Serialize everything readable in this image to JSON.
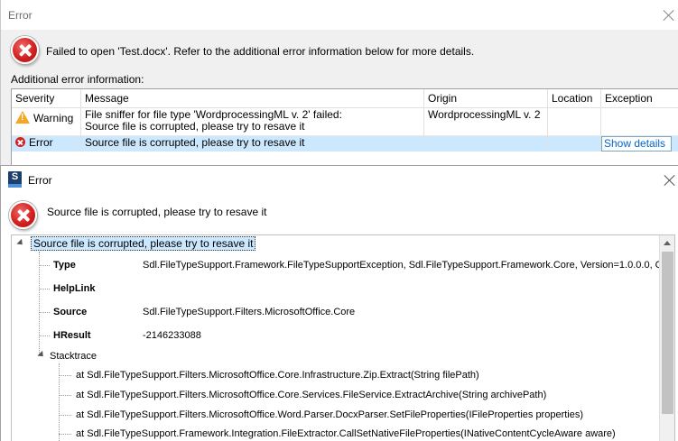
{
  "back_window": {
    "title": "Error",
    "message": "Failed to open 'Test.docx'. Refer to the additional error information below for more details.",
    "additional_label": "Additional error information:",
    "columns": [
      "Severity",
      "Message",
      "Origin",
      "Location",
      "Exception"
    ],
    "rows": [
      {
        "severity": "Warning",
        "message_line1": "File sniffer for file type 'WordprocessingML v. 2' failed:",
        "message_line2": "Source file is corrupted, please try to resave it",
        "origin": "WordprocessingML v. 2",
        "location": "",
        "exception": ""
      },
      {
        "severity": "Error",
        "message": "Source file is corrupted, please try to resave it",
        "origin": "",
        "location": "",
        "exception": "Show details"
      }
    ]
  },
  "front_window": {
    "logo_letter": "S",
    "title": "Error",
    "message": "Source file is corrupted, please try to resave it",
    "tree": {
      "root": "Source file is corrupted, please try to resave it",
      "properties": [
        {
          "name": "Type",
          "value": "Sdl.FileTypeSupport.Framework.FileTypeSupportException, Sdl.FileTypeSupport.Framework.Core, Version=1.0.0.0, C"
        },
        {
          "name": "HelpLink",
          "value": ""
        },
        {
          "name": "Source",
          "value": "Sdl.FileTypeSupport.Filters.MicrosoftOffice.Core"
        },
        {
          "name": "HResult",
          "value": "-2146233088"
        }
      ],
      "stacktrace_label": "Stacktrace",
      "stacktrace": [
        "at Sdl.FileTypeSupport.Filters.MicrosoftOffice.Core.Infrastructure.Zip.Extract(String filePath)",
        "at Sdl.FileTypeSupport.Filters.MicrosoftOffice.Core.Services.FileService.ExtractArchive(String archivePath)",
        "at Sdl.FileTypeSupport.Filters.MicrosoftOffice.Word.Parser.DocxParser.SetFileProperties(IFileProperties properties)",
        "at Sdl.FileTypeSupport.Framework.Integration.FileExtractor.CallSetNativeFileProperties(INativeContentCycleAware aware)"
      ]
    }
  }
}
